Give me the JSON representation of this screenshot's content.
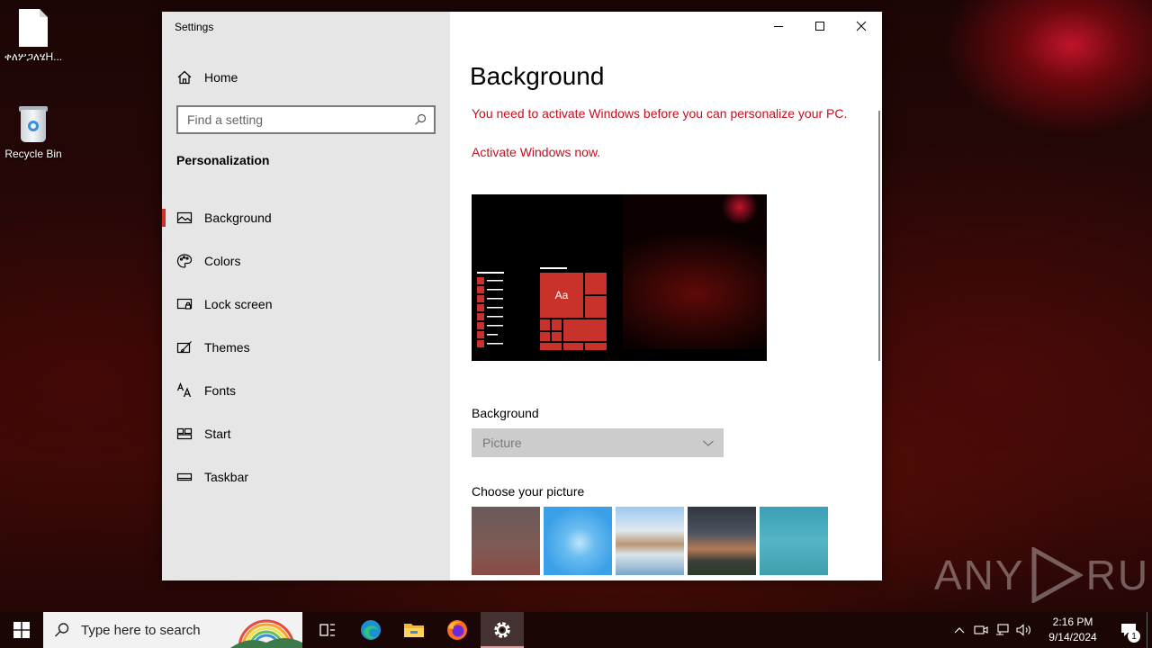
{
  "desktop": {
    "icons": [
      {
        "label": "ቀለሦጋለሄH...",
        "icon": "file-icon"
      },
      {
        "label": "Recycle Bin",
        "icon": "recycle-bin-icon"
      }
    ]
  },
  "window": {
    "title": "Settings",
    "controls": [
      "minimize-icon",
      "maximize-icon",
      "close-icon"
    ]
  },
  "sidebar": {
    "home_label": "Home",
    "search_placeholder": "Find a setting",
    "section_title": "Personalization",
    "items": [
      {
        "label": "Background",
        "icon": "picture-icon",
        "active": true
      },
      {
        "label": "Colors",
        "icon": "palette-icon",
        "active": false
      },
      {
        "label": "Lock screen",
        "icon": "lock-screen-icon",
        "active": false
      },
      {
        "label": "Themes",
        "icon": "brush-icon",
        "active": false
      },
      {
        "label": "Fonts",
        "icon": "font-icon",
        "active": false
      },
      {
        "label": "Start",
        "icon": "start-tiles-icon",
        "active": false
      },
      {
        "label": "Taskbar",
        "icon": "taskbar-icon",
        "active": false
      }
    ]
  },
  "main": {
    "title": "Background",
    "warning": "You need to activate Windows before you can personalize your PC.",
    "activate_link": "Activate Windows now.",
    "preview_tile_text": "Aa",
    "background_label": "Background",
    "background_value": "Picture",
    "choose_label": "Choose your picture",
    "pictures": [
      "thumbnail-1",
      "thumbnail-2",
      "thumbnail-3",
      "thumbnail-4",
      "thumbnail-5"
    ]
  },
  "watermark": {
    "left": "ANY",
    "right": "RUN"
  },
  "taskbar": {
    "search_text": "Type here to search",
    "apps": [
      "task-view-icon",
      "edge-icon",
      "file-explorer-icon",
      "firefox-icon",
      "settings-icon"
    ],
    "active_app": "settings-icon",
    "time": "2:16 PM",
    "date": "9/14/2024",
    "notification_count": "1"
  },
  "colors": {
    "accent": "#c9322a",
    "warning_text": "#c50f1f",
    "sidebar_bg": "#e6e6e6"
  }
}
